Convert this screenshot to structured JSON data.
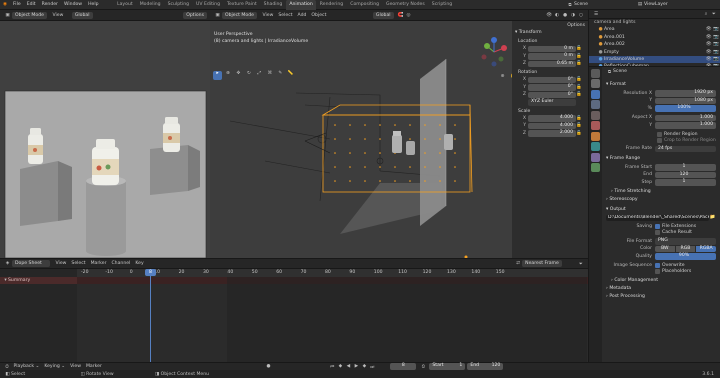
{
  "topbar": {
    "menus": [
      "File",
      "Edit",
      "Render",
      "Window",
      "Help"
    ],
    "workspaces": [
      "Layout",
      "Modeling",
      "Sculpting",
      "UV Editing",
      "Texture Paint",
      "Shading",
      "Animation",
      "Rendering",
      "Compositing",
      "Geometry Nodes",
      "Scripting"
    ],
    "active_workspace": "Animation",
    "scene": "Scene",
    "view_layer": "ViewLayer"
  },
  "left_viewport": {
    "mode": "Object Mode",
    "view": "View",
    "shading": "Global",
    "options": "Options"
  },
  "main_viewport": {
    "mode": "Object Mode",
    "menus": [
      "View",
      "Select",
      "Add",
      "Object"
    ],
    "transform_orientation": "Global",
    "overlay_title": "User Perspective",
    "overlay_subtitle": "(8) camera and lights | IrradianceVolume",
    "options": "Options"
  },
  "npanel": {
    "title": "Transform",
    "location_label": "Location",
    "location": [
      {
        "axis": "X",
        "value": "0 m"
      },
      {
        "axis": "Y",
        "value": "0 m"
      },
      {
        "axis": "Z",
        "value": "0.65 m"
      }
    ],
    "rotation_label": "Rotation",
    "rotation": [
      {
        "axis": "X",
        "value": "0°"
      },
      {
        "axis": "Y",
        "value": "0°"
      },
      {
        "axis": "Z",
        "value": "0°"
      }
    ],
    "rotation_mode": "XYZ Euler",
    "scale_label": "Scale",
    "scale": [
      {
        "axis": "X",
        "value": "4.000"
      },
      {
        "axis": "Y",
        "value": "4.000"
      },
      {
        "axis": "Z",
        "value": "2.000"
      }
    ]
  },
  "outliner": {
    "header": "camera and lights",
    "items": [
      {
        "name": "Area",
        "selected": false,
        "color": "#e09a3a"
      },
      {
        "name": "Area.001",
        "selected": false,
        "color": "#e09a3a"
      },
      {
        "name": "Area.002",
        "selected": false,
        "color": "#e09a3a"
      },
      {
        "name": "Empty",
        "selected": false,
        "color": "#9a9a9a"
      },
      {
        "name": "IrradianceVolume",
        "selected": true,
        "color": "#5aa0e0"
      },
      {
        "name": "ReflectionCubemap",
        "selected": false,
        "color": "#5aa0e0"
      }
    ]
  },
  "properties": {
    "scene_name": "Scene",
    "format_section": "Format",
    "resolution_x_label": "Resolution X",
    "resolution_x": "1920 px",
    "y_label": "Y",
    "resolution_y": "1080 px",
    "pct_label": "%",
    "resolution_pct": "100%",
    "aspect_x_label": "Aspect X",
    "aspect_x": "1.000",
    "aspect_y": "1.000",
    "render_region": "Render Region",
    "crop_region": "Crop to Render Region",
    "frame_rate_label": "Frame Rate",
    "frame_rate": "24 fps",
    "frame_range_section": "Frame Range",
    "frame_start_label": "Frame Start",
    "frame_start": "1",
    "end_label": "End",
    "frame_end": "120",
    "step_label": "Step",
    "frame_step": "1",
    "time_stretching": "Time Stretching",
    "stereoscopy": "Stereoscopy",
    "output_section": "Output",
    "output_path": "D:\\Documents\\Blender\\_Shared\\Scenes\\Pack\\",
    "saving_label": "Saving",
    "file_extensions": "File Extensions",
    "cache_result": "Cache Result",
    "file_format_label": "File Format",
    "file_format": "PNG",
    "color_label": "Color",
    "color_bw": "BW",
    "color_rgb": "RGB",
    "color_rgba": "RGBA",
    "quality_label": "Quality",
    "quality": "90%",
    "image_sequence_label": "Image Sequence",
    "overwrite": "Overwrite",
    "placeholders": "Placeholders",
    "color_management": "Color Management",
    "metadata": "Metadata",
    "post_processing": "Post Processing"
  },
  "dopesheet": {
    "mode": "Dope Sheet",
    "menus": [
      "View",
      "Select",
      "Marker",
      "Channel",
      "Key"
    ],
    "keying": "Nearest Frame",
    "summary": "Summary",
    "current_frame": "8",
    "ticks": [
      "-20",
      "-10",
      "0",
      "10",
      "20",
      "30",
      "40",
      "50",
      "60",
      "70",
      "80",
      "90",
      "100",
      "110",
      "120",
      "130",
      "140",
      "150"
    ]
  },
  "timeline": {
    "menus": [
      "Playback",
      "Keying",
      "View",
      "Marker"
    ],
    "current_frame": "8",
    "start_label": "Start",
    "start": "1",
    "end_label": "End",
    "end": "120"
  },
  "statusbar": {
    "select": "Select",
    "rotate_view": "Rotate View",
    "context_menu": "Object Context Menu",
    "version": "3.6.1"
  },
  "colors": {
    "accent": "#4772b3",
    "active_orange": "#f5a020",
    "frame_marker": "#5680c2"
  }
}
